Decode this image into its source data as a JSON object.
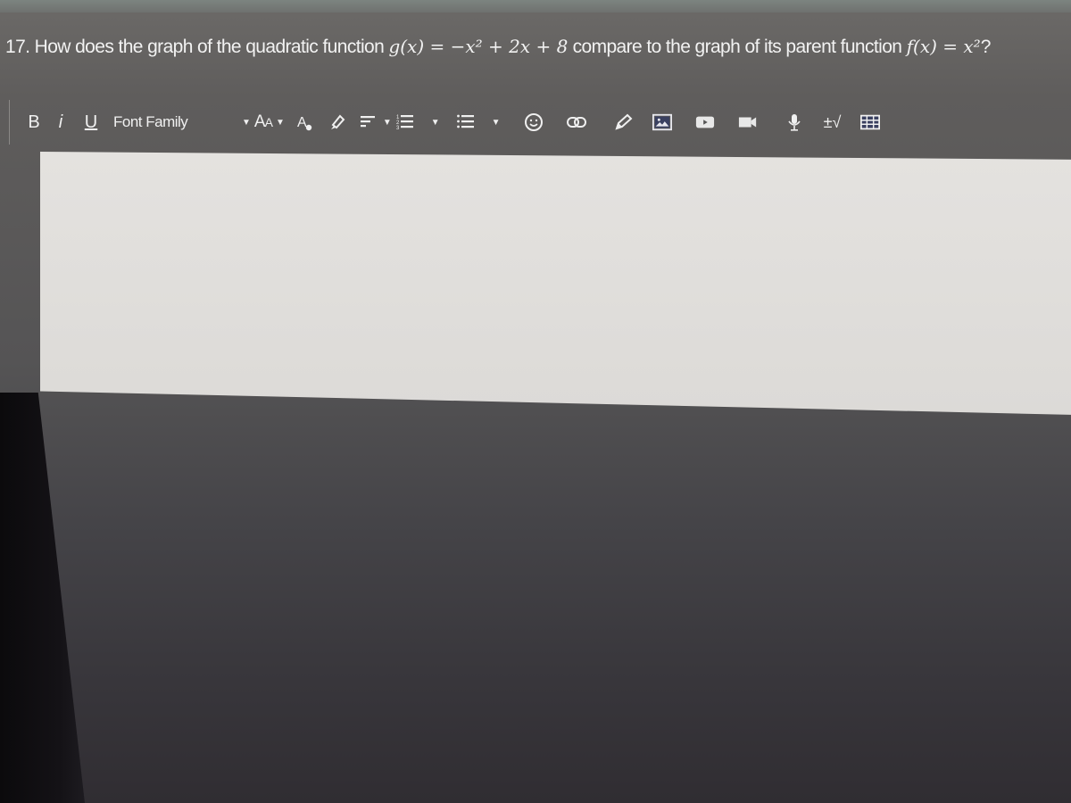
{
  "question": {
    "number": "17.",
    "text_before": "How does the graph of the quadratic function",
    "g_function": "g(x) = −x² + 2x + 8",
    "text_middle": "compare to the graph of its parent function",
    "f_function": "f(x) = x²",
    "text_end": "?"
  },
  "toolbar": {
    "bold_label": "B",
    "italic_label": "i",
    "underline_label": "U",
    "font_family_label": "Font Family",
    "font_size_label_big": "A",
    "font_size_label_small": "A",
    "items": [
      {
        "name": "bold-button",
        "icon": "bold"
      },
      {
        "name": "italic-button",
        "icon": "italic"
      },
      {
        "name": "underline-button",
        "icon": "underline"
      },
      {
        "name": "font-family-dropdown",
        "icon": "caret-down"
      },
      {
        "name": "font-size-dropdown",
        "icon": "font-size"
      },
      {
        "name": "text-color-button",
        "icon": "text-color"
      },
      {
        "name": "highlight-button",
        "icon": "highlighter"
      },
      {
        "name": "align-dropdown",
        "icon": "align-left"
      },
      {
        "name": "numbered-list-dropdown",
        "icon": "ordered-list"
      },
      {
        "name": "bullet-list-dropdown",
        "icon": "unordered-list"
      },
      {
        "name": "emoji-button",
        "icon": "smiley"
      },
      {
        "name": "link-button",
        "icon": "link"
      },
      {
        "name": "draw-button",
        "icon": "pencil"
      },
      {
        "name": "image-button",
        "icon": "image"
      },
      {
        "name": "youtube-button",
        "icon": "play"
      },
      {
        "name": "video-button",
        "icon": "video-camera"
      },
      {
        "name": "audio-button",
        "icon": "microphone"
      },
      {
        "name": "math-button",
        "icon": "plus-minus-sqrt"
      },
      {
        "name": "table-button",
        "icon": "table"
      }
    ],
    "math_label": "±√"
  },
  "editor": {
    "value": "",
    "placeholder": ""
  }
}
